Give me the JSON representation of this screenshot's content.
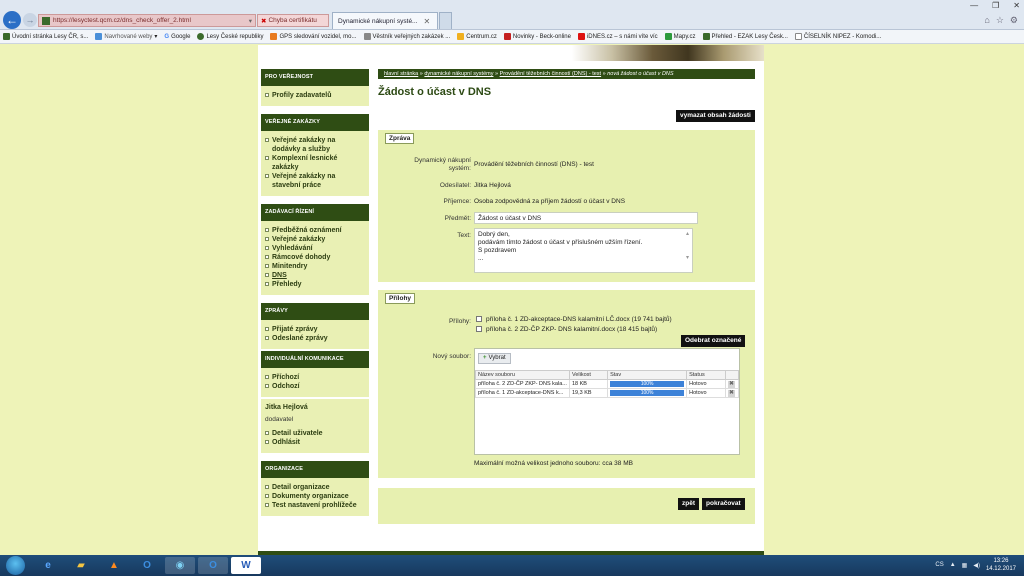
{
  "browser": {
    "address": "https://lesyctest.qcm.cz/dns_check_offer_2.html",
    "cert_error": "Chyba certifikátu",
    "tabs": [
      {
        "label": "Dynamické nákupní systé...",
        "active": true
      },
      {
        "label": "",
        "active": false
      }
    ],
    "bookmarks": [
      "Úvodní stránka Lesy ČR, s...",
      "Navrhované weby",
      "Google",
      "Lesy České republiky",
      "GPS sledování vozidel, mo...",
      "Věstník veřejných zakázek ...",
      "Centrum.cz",
      "Novinky - Beck-online",
      "iDNES.cz – s námi víte víc",
      "Mapy.cz",
      "Přehled - EZAK Lesy Česk...",
      "ČÍSELNÍK NIPEZ - Komodi..."
    ]
  },
  "sidebar": {
    "public_head": "PRO VEŘEJNOST",
    "public_items": [
      "Profily zadavatelů"
    ],
    "contracts_head": "VEŘEJNÉ ZAKÁZKY",
    "contracts_items": [
      "Veřejné zakázky na dodávky a služby",
      "Komplexní lesnické zakázky",
      "Veřejné zakázky na stavební práce"
    ],
    "proc_head": "ZADÁVACÍ ŘÍZENÍ",
    "proc_items": [
      "Předběžná oznámení",
      "Veřejné zakázky",
      "Vyhledávání",
      "Rámcové dohody",
      "Minitendry",
      "DNS",
      "Přehledy"
    ],
    "messages_head": "ZPRÁVY",
    "messages_items": [
      "Přijaté zprávy",
      "Odeslané zprávy"
    ],
    "comm_head": "INDIVIDUÁLNÍ KOMUNIKACE",
    "comm_items": [
      "Příchozí",
      "Odchozí"
    ],
    "user_name": "Jitka Hejlová",
    "user_role": "dodavatel",
    "user_items": [
      "Detail uživatele",
      "Odhlásit"
    ],
    "org_head": "ORGANIZACE",
    "org_items": [
      "Detail organizace",
      "Dokumenty organizace",
      "Test nastavení prohlížeče"
    ]
  },
  "breadcrumb": {
    "items": [
      "hlavní stránka",
      "dynamické nákupní systémy",
      "Provádění těžebních činností (DNS) - test"
    ],
    "sep": " » ",
    "current": "nová žádost o účast v DNS"
  },
  "main": {
    "title": "Žádost o účast v DNS",
    "clear_button": "vymazat obsah žádosti",
    "message_section": "Zpráva",
    "dns_label": "Dynamický nákupní systém:",
    "dns_value": "Provádění těžebních činností (DNS) - test",
    "sender_label": "Odesílatel:",
    "sender_value": "Jitka Hejlová",
    "recipient_label": "Příjemce:",
    "recipient_value": "Osoba zodpovědná za příjem žádostí o účast v DNS",
    "subject_label": "Předmět:",
    "subject_value": "Žádost o účast v DNS",
    "text_label": "Text:",
    "text_lines": [
      "Dobrý den,",
      "podávám tímto žádost o účast v příslušném užším řízení.",
      "S pozdravem",
      "..."
    ],
    "attachments_section": "Přílohy",
    "attachments_label": "Přílohy:",
    "attachments": [
      "příloha č. 1 ZD-akceptace-DNS kalamitní LČ.docx (19 741 bajtů)",
      "příloha č. 2 ZD-ČP ZKP- DNS kalamitní.docx (18 415 bajtů)"
    ],
    "remove_selected": "Odebrat označené",
    "new_file_label": "Nový soubor:",
    "choose_button": "Vybrat",
    "file_table": {
      "headers": [
        "Název souboru",
        "Velikost",
        "Stav",
        "Status"
      ],
      "rows": [
        {
          "name": "příloha č. 2 ZD-ČP ZKP- DNS kala...",
          "size": "18 KB",
          "progress": "100%",
          "status": "Hotovo"
        },
        {
          "name": "příloha č. 1 ZD-akceptace-DNS k...",
          "size": "19,3 KB",
          "progress": "100%",
          "status": "Hotovo"
        }
      ]
    },
    "max_size": "Maximální možná velikost jednoho souboru: cca 38 MB",
    "back_button": "zpět",
    "continue_button": "pokračovat"
  },
  "taskbar": {
    "lang": "CS",
    "time": "13:26",
    "date": "14.12.2017"
  }
}
